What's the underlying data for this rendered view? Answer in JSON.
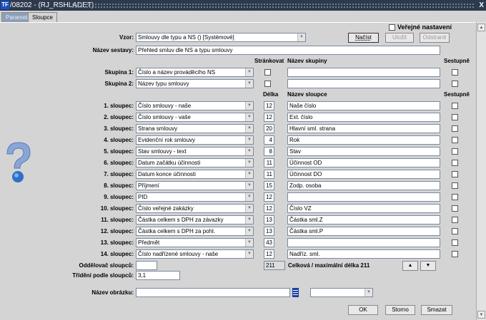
{
  "window": {
    "logo": "TF",
    "title": "/08202 - (RJ_RSHLADET)",
    "close": "X"
  },
  "tabs": [
    {
      "label": "Parametry"
    },
    {
      "label": "Sloupce"
    }
  ],
  "public_setting": {
    "label": "Veřejné nastavení",
    "checked": false
  },
  "vzor": {
    "label": "Vzor:",
    "value": "Smlouvy dle typu a NS   ()   [Systémové]"
  },
  "buttons": {
    "load": "Načíst",
    "save": "Uložit",
    "remove": "Odstranit",
    "ok": "OK",
    "cancel": "Storno",
    "delete": "Smazat",
    "up": "▲",
    "down": "▼"
  },
  "report_name": {
    "label": "Název sestavy:",
    "value": "Přehled smluv dle NS a typu smlouvy"
  },
  "group_headers": {
    "paging": "Stránkovat",
    "group_name": "Název skupiny",
    "descending": "Sestupně"
  },
  "groups": [
    {
      "label": "Skupina 1:",
      "value": "Číslo a název prováděcího NS",
      "name": ""
    },
    {
      "label": "Skupina 2:",
      "value": "Název typu smlouvy",
      "name": ""
    }
  ],
  "column_headers": {
    "length": "Délka",
    "column_name": "Název sloupce",
    "descending": "Sestupně"
  },
  "columns": [
    {
      "label": "1. sloupec:",
      "value": "Číslo smlouvy - naše",
      "length": "12",
      "name": "Naše číslo"
    },
    {
      "label": "2. sloupec:",
      "value": "Číslo smlouvy - vaše",
      "length": "12",
      "name": "Ext. číslo"
    },
    {
      "label": "3. sloupec:",
      "value": "Strana smlouvy",
      "length": "20",
      "name": "Hlavní sml. strana"
    },
    {
      "label": "4. sloupec:",
      "value": "Evidenční rok smlouvy",
      "length": "4",
      "name": "Rok"
    },
    {
      "label": "5. sloupec:",
      "value": "Stav smlouvy - text",
      "length": "8",
      "name": "Stav"
    },
    {
      "label": "6. sloupec:",
      "value": "Datum začátku účinnosti",
      "length": "11",
      "name": "Účinnost OD"
    },
    {
      "label": "7. sloupec:",
      "value": "Datum konce účinnosti",
      "length": "11",
      "name": "Účinnost DO"
    },
    {
      "label": "8. sloupec:",
      "value": "Příjmení",
      "length": "15",
      "name": "Zodp. osoba"
    },
    {
      "label": "9. sloupec:",
      "value": "PID",
      "length": "12",
      "name": ""
    },
    {
      "label": "10. sloupec:",
      "value": "Číslo veřejné zakázky",
      "length": "12",
      "name": "Číslo VZ"
    },
    {
      "label": "11. sloupec:",
      "value": "Částka celkem s DPH za závazky",
      "length": "13",
      "name": "Částka sml.Z"
    },
    {
      "label": "12. sloupec:",
      "value": "Částka celkem s DPH za pohl.",
      "length": "13",
      "name": "Částka sml.P"
    },
    {
      "label": "13. sloupec:",
      "value": "Předmět",
      "length": "43",
      "name": ""
    },
    {
      "label": "14. sloupec:",
      "value": "Číslo nadřízené smlouvy - naše",
      "length": "12",
      "name": "Nadříz. sml."
    }
  ],
  "separator": {
    "label": "Oddělovač sloupců:",
    "value": ""
  },
  "total": {
    "value": "211",
    "label": "Celková / maximální délka 211"
  },
  "sort": {
    "label": "Třídění podle sloupců:",
    "value": "3,1"
  },
  "image": {
    "label": "Název obrázku:",
    "value": "",
    "select": ""
  }
}
